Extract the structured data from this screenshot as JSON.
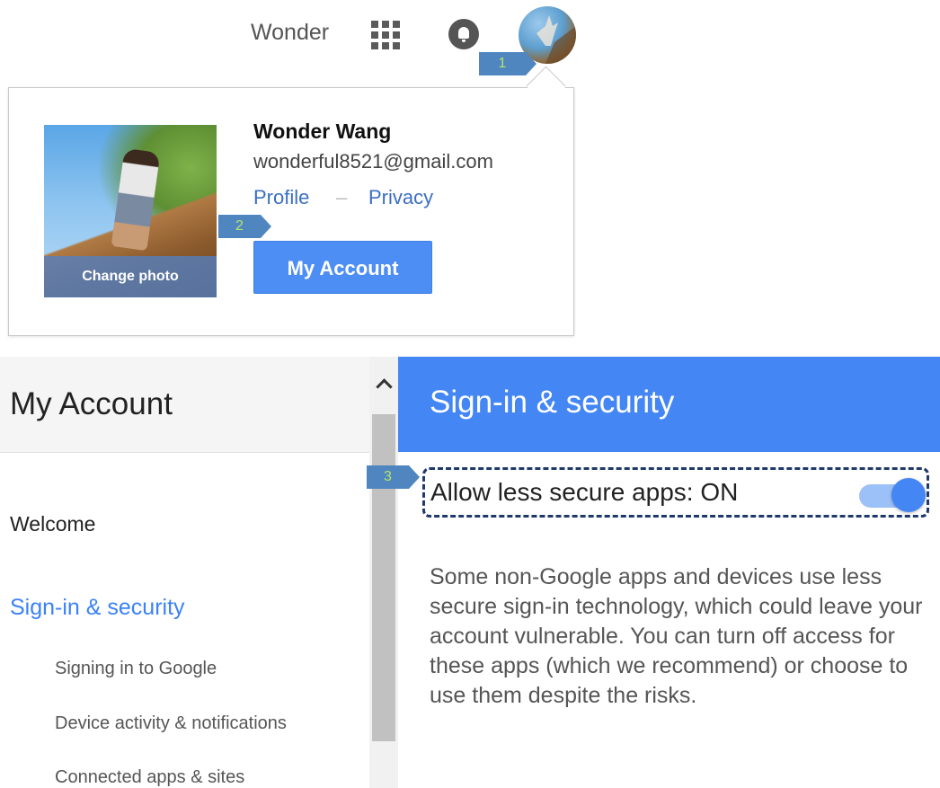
{
  "topbar": {
    "user_name": "Wonder",
    "icons": [
      "apps-grid-icon",
      "notifications-icon",
      "avatar"
    ]
  },
  "markers": [
    "1",
    "2",
    "3"
  ],
  "popup": {
    "full_name": "Wonder Wang",
    "email": "wonderful8521@gmail.com",
    "profile_link": "Profile",
    "separator": "–",
    "privacy_link": "Privacy",
    "change_photo": "Change photo",
    "my_account_button": "My Account"
  },
  "sidebar": {
    "title": "My Account",
    "items": [
      {
        "label": "Welcome",
        "active": false
      },
      {
        "label": "Sign-in & security",
        "active": true
      }
    ],
    "sub_items": [
      "Signing in to Google",
      "Device activity & notifications",
      "Connected apps & sites"
    ]
  },
  "main": {
    "title": "Sign-in & security",
    "setting_label": "Allow less secure apps: ON",
    "toggle_on": true,
    "description": "Some non-Google apps and devices use less secure sign-in technology, which could leave your account vulnerable. You can turn off access for these apps (which we recommend) or choose to use them despite the risks."
  },
  "colors": {
    "accent": "#4486f4",
    "link": "#3b6fc1",
    "marker": "#4f86c0",
    "marker_text": "#b7e36a"
  }
}
